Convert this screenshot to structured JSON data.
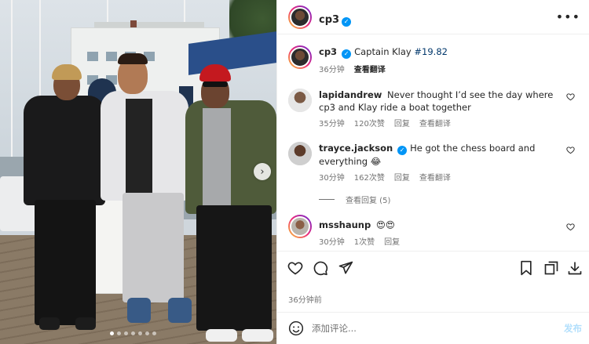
{
  "post": {
    "author": "cp3",
    "caption_text": "Captain Klay ",
    "caption_tag": "#19.82",
    "caption_age": "36分钟",
    "see_translation": "查看翻译",
    "posted_ago": "36分钟前"
  },
  "media": {
    "carousel_count": 7,
    "carousel_active_index": 0
  },
  "comments": [
    {
      "username": "lapidandrew",
      "verified": false,
      "text": "Never thought I’d see the day where cp3 and Klay ride a boat together",
      "age": "35分钟",
      "likes": "120次赞",
      "reply": "回复",
      "translate": "查看翻译"
    },
    {
      "username": "trayce.jackson",
      "verified": true,
      "text": "He got the chess board and everything 😂",
      "age": "30分钟",
      "likes": "162次赞",
      "reply": "回复",
      "translate": "查看翻译",
      "view_replies": "查看回复 (5)"
    },
    {
      "username": "msshaunp",
      "verified": false,
      "text": "😍😍",
      "age": "30分钟",
      "likes": "1次赞",
      "reply": "回复"
    }
  ],
  "composer": {
    "placeholder": "添加评论...",
    "post_label": "发布"
  },
  "icons": {
    "more": "more-icon",
    "like": "heart-icon",
    "comment": "comment-icon",
    "share": "send-icon",
    "save": "bookmark-icon",
    "embed": "copy-icon",
    "download": "download-icon",
    "emoji": "emoji-icon",
    "next": "chevron-right-icon"
  },
  "colors": {
    "verified": "#0095f6",
    "hashtag": "#00376b",
    "muted": "#737373",
    "post_disabled": "#b2dffc"
  }
}
